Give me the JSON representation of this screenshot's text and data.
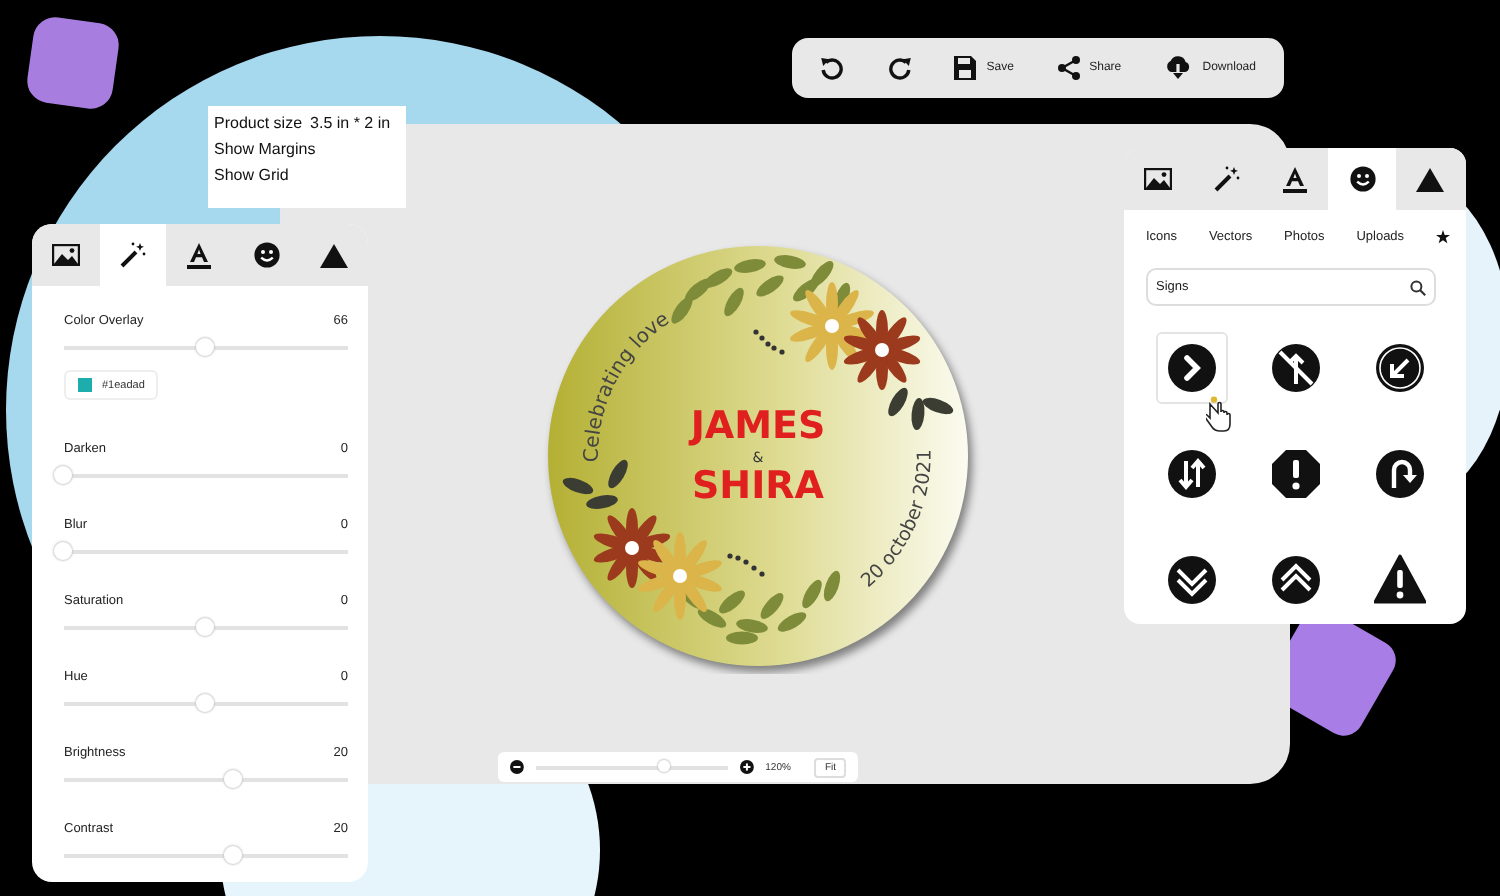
{
  "toolbar": {
    "buttons": [
      {
        "kind": "undo"
      },
      {
        "kind": "redo"
      },
      {
        "kind": "save",
        "label": "Save"
      },
      {
        "kind": "share",
        "label": "Share"
      },
      {
        "kind": "download",
        "label": "Download"
      }
    ]
  },
  "product_menu": {
    "product_size": {
      "label": "Product size",
      "value": "3.5 in * 2 in"
    },
    "items": [
      "Show Margins",
      "Show Grid"
    ]
  },
  "left_panel": {
    "tabs": [
      {
        "kind": "image",
        "selected": false
      },
      {
        "kind": "wand",
        "selected": true
      },
      {
        "kind": "text",
        "selected": false
      },
      {
        "kind": "smiley",
        "selected": false
      },
      {
        "kind": "shape",
        "selected": false
      }
    ],
    "adjustments": [
      {
        "label": "Color Overlay",
        "reading": "66",
        "level": 0.5,
        "swatch": {
          "color": "#1eadad",
          "label": "#1eadad"
        }
      },
      {
        "label": "Darken",
        "reading": "0",
        "level": 0
      },
      {
        "label": "Blur",
        "reading": "0",
        "level": 0
      },
      {
        "label": "Saturation",
        "reading": "0",
        "level": 0.5
      },
      {
        "label": "Hue",
        "reading": "0",
        "level": 0.5
      },
      {
        "label": "Brightness",
        "reading": "20",
        "level": 0.6
      },
      {
        "label": "Contrast",
        "reading": "20",
        "level": 0.6
      }
    ]
  },
  "canvas": {
    "sticker": {
      "arc_top": "Celebrating love",
      "name_1": "JAMES",
      "ampersand": "&",
      "name_2": "SHIRA",
      "arc_bottom": "20 october 2021"
    },
    "zoom": {
      "level": 0.67,
      "reading": "120%",
      "fit": "Fit"
    }
  },
  "right_panel": {
    "tabs": [
      {
        "kind": "image",
        "selected": false
      },
      {
        "kind": "wand",
        "selected": false
      },
      {
        "kind": "text",
        "selected": false
      },
      {
        "kind": "smiley",
        "selected": true
      },
      {
        "kind": "shape",
        "selected": false
      }
    ],
    "categories": [
      "Icons",
      "Vectors",
      "Photos",
      "Uploads"
    ],
    "search": {
      "value": "Signs"
    },
    "signs": [
      {
        "kind": "chevron",
        "selected": true
      },
      {
        "kind": "no-straight",
        "selected": false
      },
      {
        "kind": "arrow-down-left",
        "selected": false
      },
      {
        "kind": "two-way",
        "selected": false
      },
      {
        "kind": "exclamation-octagon",
        "selected": false
      },
      {
        "kind": "u-turn",
        "selected": false
      },
      {
        "kind": "chevrons-down",
        "selected": false
      },
      {
        "kind": "chevrons-up",
        "selected": false
      },
      {
        "kind": "warning",
        "selected": false
      }
    ]
  }
}
